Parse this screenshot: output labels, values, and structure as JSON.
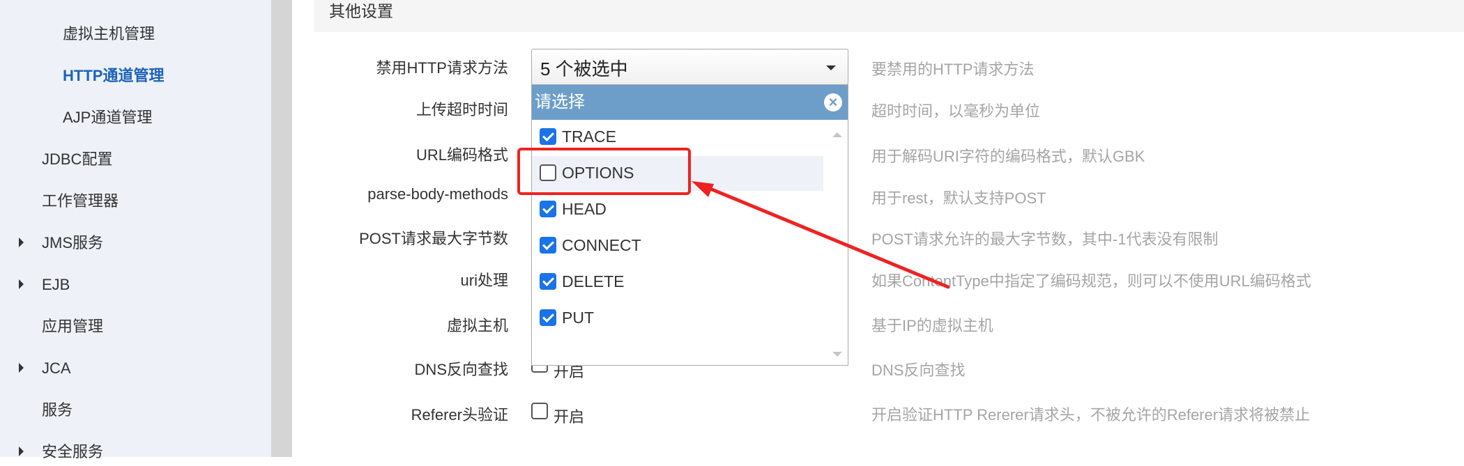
{
  "sidebar": {
    "items": [
      {
        "label": "虚拟主机管理",
        "active": false,
        "has_caret": false
      },
      {
        "label": "HTTP通道管理",
        "active": true,
        "has_caret": false
      },
      {
        "label": "AJP通道管理",
        "active": false,
        "has_caret": false
      },
      {
        "label": "JDBC配置",
        "active": false,
        "has_caret": false
      },
      {
        "label": "工作管理器",
        "active": false,
        "has_caret": false
      },
      {
        "label": "JMS服务",
        "active": false,
        "has_caret": true
      },
      {
        "label": "EJB",
        "active": false,
        "has_caret": true
      },
      {
        "label": "应用管理",
        "active": false,
        "has_caret": false
      },
      {
        "label": "JCA",
        "active": false,
        "has_caret": true
      },
      {
        "label": "服务",
        "active": false,
        "has_caret": false
      },
      {
        "label": "安全服务",
        "active": false,
        "has_caret": true
      }
    ]
  },
  "section": {
    "title": "其他设置"
  },
  "form": {
    "rows": [
      {
        "label": "禁用HTTP请求方法",
        "hint": "要禁用的HTTP请求方法"
      },
      {
        "label": "上传超时时间",
        "hint": "超时时间，以毫秒为单位"
      },
      {
        "label": "URL编码格式",
        "hint": "用于解码URI字符的编码格式，默认GBK"
      },
      {
        "label": "parse-body-methods",
        "hint": "用于rest，默认支持POST"
      },
      {
        "label": "POST请求最大字节数",
        "hint": "POST请求允许的最大字节数，其中-1代表没有限制"
      },
      {
        "label": "uri处理",
        "hint": "如果ContentType中指定了编码规范，则可以不使用URL编码格式"
      },
      {
        "label": "虚拟主机",
        "hint": "基于IP的虚拟主机"
      },
      {
        "label": "DNS反向查找",
        "hint": "DNS反向查找",
        "checkbox_label": "开启",
        "checked": false
      },
      {
        "label": "Referer头验证",
        "hint": "开启验证HTTP Rererer请求头，不被允许的Referer请求将被禁止",
        "checkbox_label": "开启",
        "checked": false
      }
    ]
  },
  "multiselect": {
    "value": "5 个被选中",
    "header": "请选择",
    "close_icon": "close-circle-icon",
    "options": [
      {
        "label": "TRACE",
        "checked": true
      },
      {
        "label": "OPTIONS",
        "checked": false
      },
      {
        "label": "HEAD",
        "checked": true
      },
      {
        "label": "CONNECT",
        "checked": true
      },
      {
        "label": "DELETE",
        "checked": true
      },
      {
        "label": "PUT",
        "checked": true
      }
    ]
  },
  "colors": {
    "accent": "#1d63b8",
    "dropdown_header": "#6d9ec9",
    "checkbox_checked": "#1a73e8",
    "annotation": "#ee2222",
    "sidebar_bg": "#eef1f7",
    "hint_text": "#a5a5a5"
  }
}
